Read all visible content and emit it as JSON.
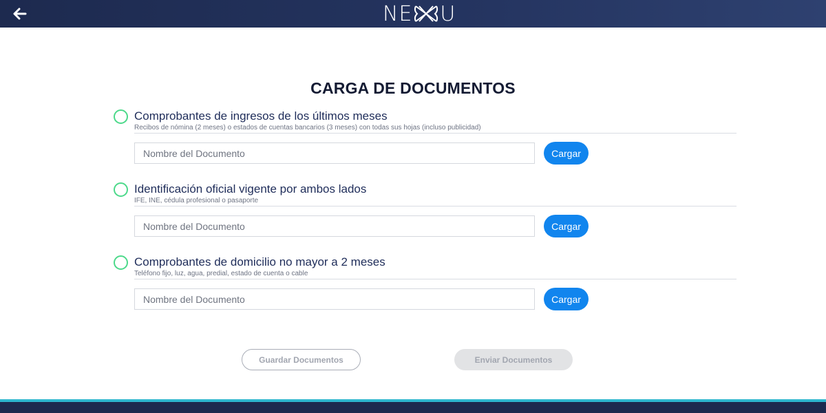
{
  "header": {
    "back_icon": "arrow-left-icon",
    "logo_text_left": "NE",
    "logo_text_right": "U",
    "logo_mark_icon": "interlaced-x-mark-icon"
  },
  "page": {
    "title": "CARGA DE DOCUMENTOS"
  },
  "sections": [
    {
      "status_icon": "circle-outline-icon",
      "heading": "Comprobantes de ingresos de los últimos meses",
      "description": "Recibos de nómina (2 meses) o estados de cuentas bancarios (3 meses) con todas sus hojas (incluso publicidad)",
      "input_placeholder": "Nombre del Documento",
      "input_value": "",
      "upload_label": "Cargar"
    },
    {
      "status_icon": "circle-outline-icon",
      "heading": "Identificación oficial vigente por ambos lados",
      "description": "IFE, INE, cédula profesional o pasaporte",
      "input_placeholder": "Nombre del Documento",
      "input_value": "",
      "upload_label": "Cargar"
    },
    {
      "status_icon": "circle-outline-icon",
      "heading": "Comprobantes de domicilio no mayor a 2 meses",
      "description": "Teléfono fijo, luz, agua, predial, estado de cuenta o cable",
      "input_placeholder": "Nombre del Documento",
      "input_value": "",
      "upload_label": "Cargar"
    }
  ],
  "actions": {
    "save_label": "Guardar Documentos",
    "send_label": "Enviar Documentos"
  },
  "colors": {
    "header_bg": "#1d2a4f",
    "accent_blue": "#1185ee",
    "status_green": "#4cd98a",
    "footer_accent": "#2eb7cf",
    "heading_text": "#1f2d5a"
  }
}
